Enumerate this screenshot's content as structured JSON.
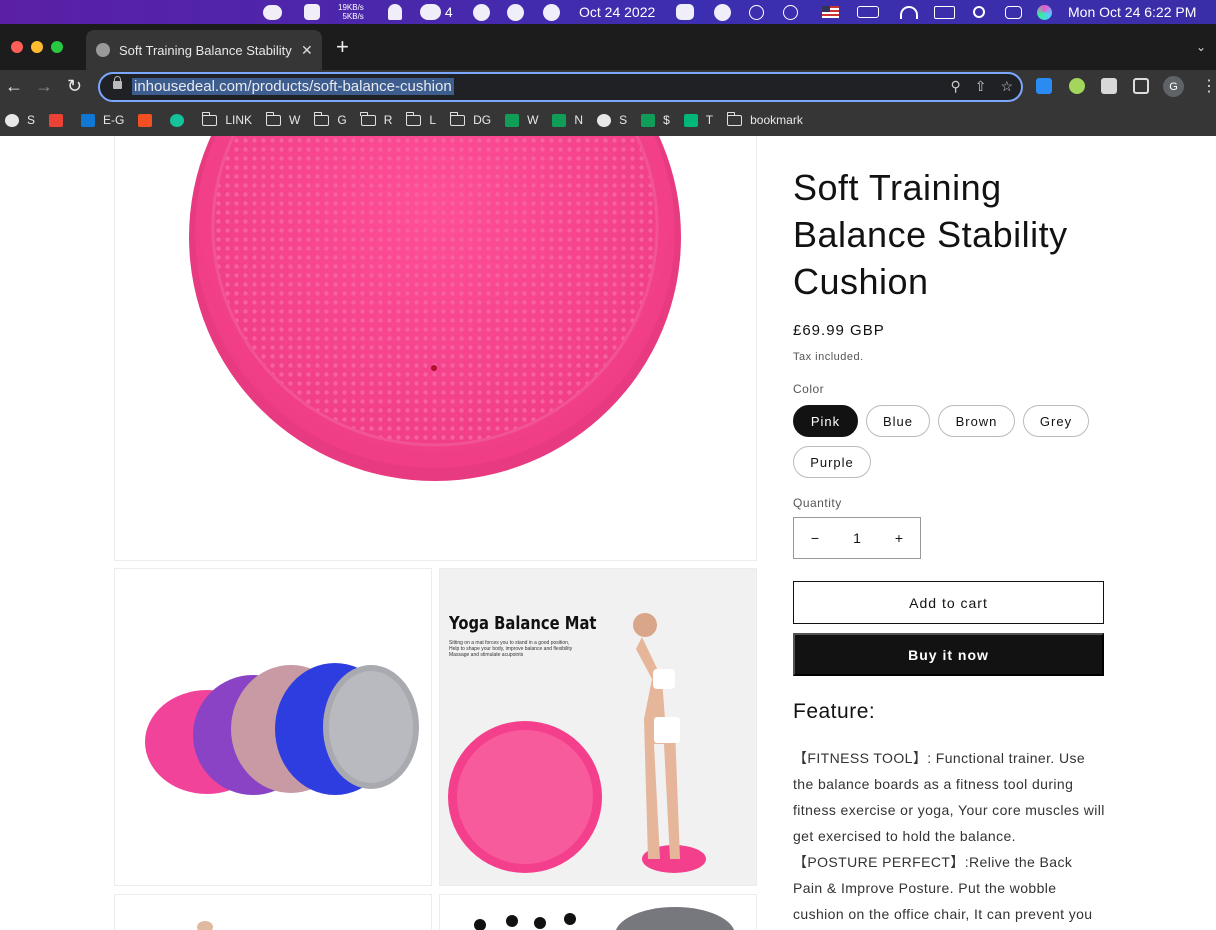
{
  "menubar": {
    "net_up": "19KB/s",
    "net_down": "5KB/s",
    "chat_badge": "4",
    "date_center": "Oct 24 2022",
    "clock": "Mon Oct 24  6:22 PM"
  },
  "browser": {
    "tab_title": "Soft Training Balance Stability Cushion",
    "tab_close": "✕",
    "new_tab": "+",
    "url": "inhousedeal.com/products/soft-balance-cushion",
    "profile_initial": "G",
    "bookmarks": [
      {
        "label": "S",
        "icon": "globe-icon",
        "color": "#e8e8e8"
      },
      {
        "label": "",
        "icon": "gmail-icon",
        "color": "#ea4335"
      },
      {
        "label": "E-G",
        "icon": "outlook-icon",
        "color": "#0f78d4"
      },
      {
        "label": "",
        "icon": "microsoft-icon",
        "color": "#f25022"
      },
      {
        "label": "",
        "icon": "grammarly-icon",
        "color": "#15c39a"
      },
      {
        "label": "LINK",
        "icon": "folder-icon"
      },
      {
        "label": "W",
        "icon": "folder-icon"
      },
      {
        "label": "G",
        "icon": "folder-icon"
      },
      {
        "label": "R",
        "icon": "folder-icon"
      },
      {
        "label": "L",
        "icon": "folder-icon"
      },
      {
        "label": "DG",
        "icon": "folder-icon"
      },
      {
        "label": "W",
        "icon": "sheets-icon",
        "color": "#0f9d58"
      },
      {
        "label": "N",
        "icon": "sheets-icon",
        "color": "#0f9d58"
      },
      {
        "label": "S",
        "icon": "globe-icon",
        "color": "#e8e8e8"
      },
      {
        "label": "$",
        "icon": "sheets-icon",
        "color": "#0f9d58"
      },
      {
        "label": "T",
        "icon": "star-icon",
        "color": "#00b67a"
      },
      {
        "label": "bookmark",
        "icon": "folder-icon"
      }
    ]
  },
  "product": {
    "title": "Soft Training Balance Stability Cushion",
    "price": "£69.99 GBP",
    "tax_note": "Tax included.",
    "color_label": "Color",
    "colors": [
      "Pink",
      "Blue",
      "Brown",
      "Grey",
      "Purple"
    ],
    "selected_color": "Pink",
    "quantity_label": "Quantity",
    "quantity": "1",
    "qty_minus": "−",
    "qty_plus": "+",
    "add_to_cart": "Add to cart",
    "buy_now": "Buy it now",
    "feature_heading": "Feature:",
    "feature_1": "【FITNESS TOOL】: Functional trainer. Use the balance boards as a fitness tool during fitness exercise or yoga, Your core muscles will get exercised to hold the balance.",
    "feature_2": "【POSTURE PERFECT】:Relive the Back Pain & Improve Posture. Put the wobble cushion on the office chair, It can prevent you from working"
  },
  "gallery": {
    "promo_title": "Yoga Balance Mat",
    "promo_line_1": "Sitting on a mat forces you to stand in a good position,",
    "promo_line_2": "Help to shape your body, improve balance and flexibility",
    "promo_line_3": "Massage and stimulate acupoints"
  },
  "colors": {
    "accent_pink": "#f0458f",
    "dark": "#121212"
  }
}
